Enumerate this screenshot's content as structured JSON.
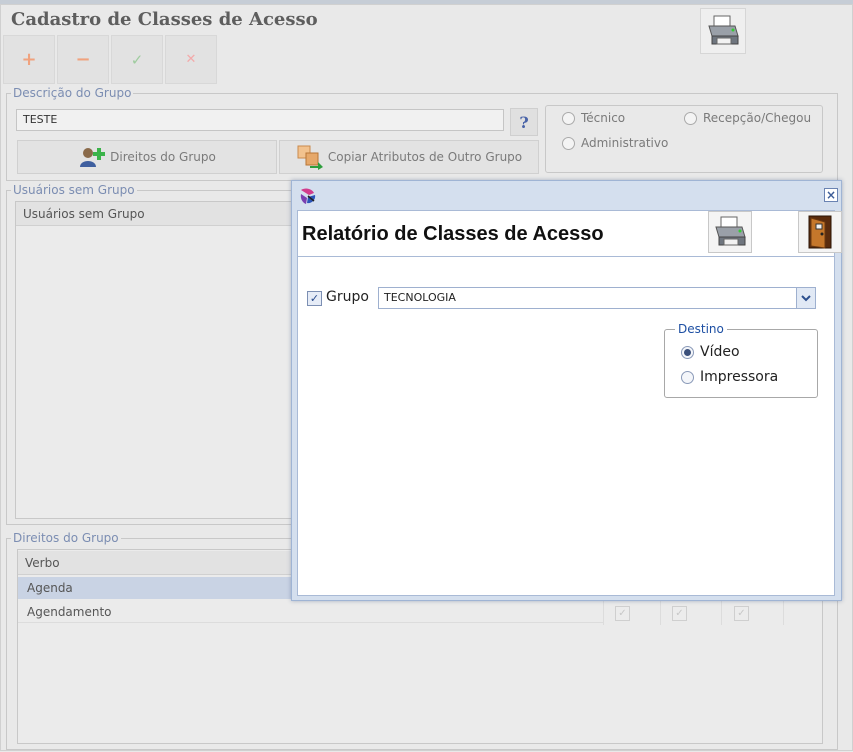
{
  "page": {
    "title": "Cadastro de Classes de Acesso"
  },
  "toolbar": {
    "add": "+",
    "remove": "−",
    "confirm": "✓",
    "cancel": "✕"
  },
  "group_description": {
    "legend": "Descrição do Grupo",
    "name_value": "TESTE",
    "help_label": "?",
    "rights_button": "Direitos do Grupo",
    "copy_button": "Copiar Atributos de Outro Grupo",
    "options": [
      "Técnico",
      "Recepção/Chegou",
      "Administrativo"
    ]
  },
  "users_without_group": {
    "legend": "Usuários sem Grupo",
    "column": "Usuários sem Grupo"
  },
  "group_rights": {
    "legend": "Direitos do Grupo",
    "column": "Verbo",
    "rows": [
      "Agenda",
      "Agendamento"
    ]
  },
  "report_dialog": {
    "title": "Relatório de Classes de Acesso",
    "close_label": "×",
    "group_checkbox_label": "Grupo",
    "group_value": "TECNOLOGIA",
    "destination": {
      "legend": "Destino",
      "options": [
        "Vídeo",
        "Impressora"
      ],
      "selected": "Vídeo"
    }
  },
  "colors": {
    "accent": "#7b8db2",
    "row_selected": "#c9d3e4",
    "dialog_border": "#9fb4d4"
  }
}
